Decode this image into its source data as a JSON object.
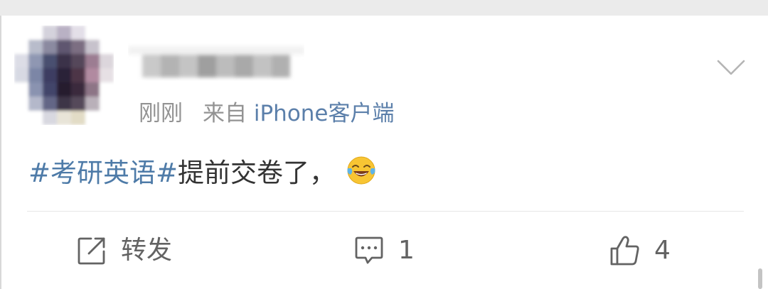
{
  "post": {
    "time": "刚刚",
    "source_prefix": "来自",
    "source_app": "iPhone客户端",
    "hashtag": "#考研英语#",
    "text": "提前交卷了，",
    "emoji": "laughing-tears-emoji"
  },
  "actions": {
    "repost_label": "转发",
    "comment_count": "1",
    "like_count": "4"
  },
  "icons": {
    "more": "chevron-down-icon",
    "repost": "share-icon",
    "comment": "comment-icon",
    "like": "thumbs-up-icon"
  },
  "colors": {
    "link": "#4e7ba8",
    "meta_text": "#939393",
    "body_text": "#333333",
    "action_text": "#636363"
  }
}
